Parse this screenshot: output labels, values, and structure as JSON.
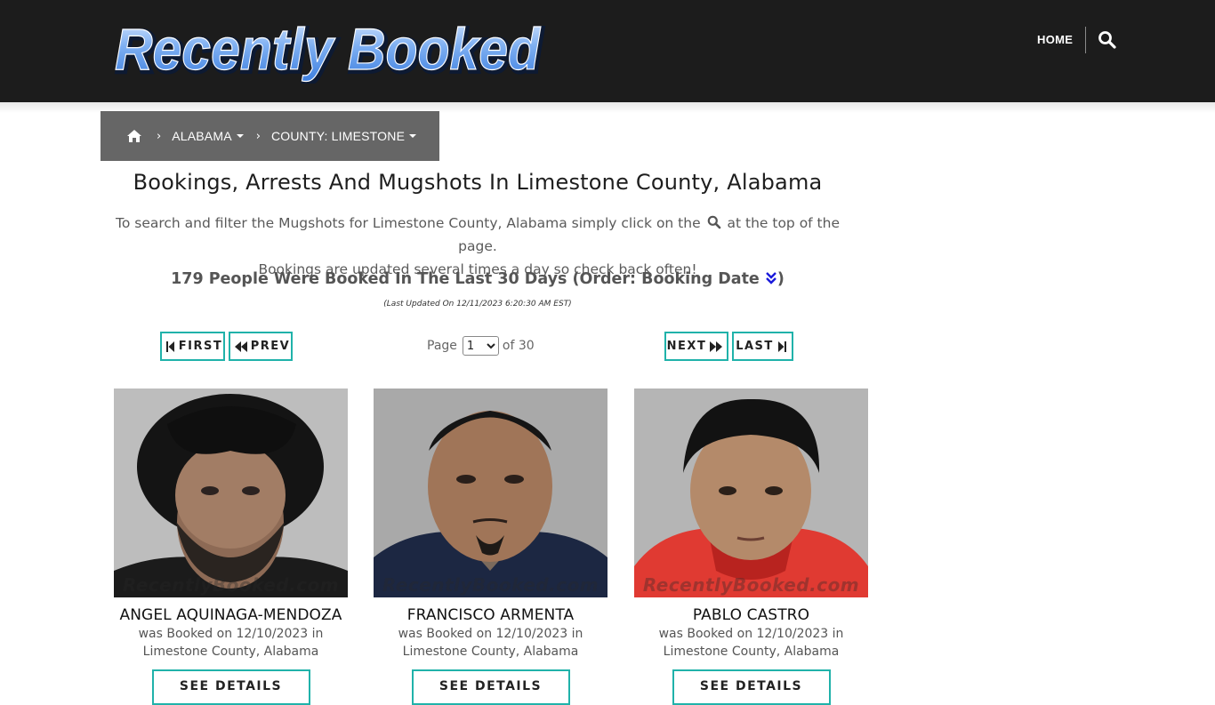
{
  "header": {
    "logo_text": "Recently Booked",
    "nav_home": "HOME",
    "search_icon": "search-icon"
  },
  "breadcrumb": {
    "home_icon": "home-icon",
    "state": "ALABAMA",
    "county": "COUNTY: LIMESTONE"
  },
  "page": {
    "title": "Bookings, Arrests And Mugshots In Limestone County, Alabama",
    "intro_part1": "To search and filter the Mugshots for Limestone County, Alabama simply click on the",
    "intro_part2": "at the top of the page.",
    "intro_line2": "Bookings are updated several times a day so check back often!",
    "count_text": "179 People Were Booked In The Last 30 Days (Order: Booking Date",
    "count_close": ")",
    "last_updated": "(Last Updated On 12/11/2023 6:20:30 AM EST)"
  },
  "pagination": {
    "first": "FIRST",
    "prev": "PREV",
    "next": "NEXT",
    "last": "LAST",
    "page_label": "Page",
    "current_page": "1",
    "of_label": "of 30"
  },
  "watermark": "RecentlyBooked.com",
  "colors": {
    "header_bg": "#1c1c1c",
    "breadcrumb_bg": "#666666",
    "accent_teal": "#20b2aa",
    "order_icon_blue": "#1a1adb"
  },
  "cards": [
    {
      "name": "ANGEL AQUINAGA-MENDOZA",
      "line1": "was Booked on 12/10/2023 in",
      "line2": "Limestone County, Alabama",
      "button": "SEE DETAILS"
    },
    {
      "name": "FRANCISCO ARMENTA",
      "line1": "was Booked on 12/10/2023 in",
      "line2": "Limestone County, Alabama",
      "button": "SEE DETAILS"
    },
    {
      "name": "PABLO CASTRO",
      "line1": "was Booked on 12/10/2023 in",
      "line2": "Limestone County, Alabama",
      "button": "SEE DETAILS"
    }
  ]
}
